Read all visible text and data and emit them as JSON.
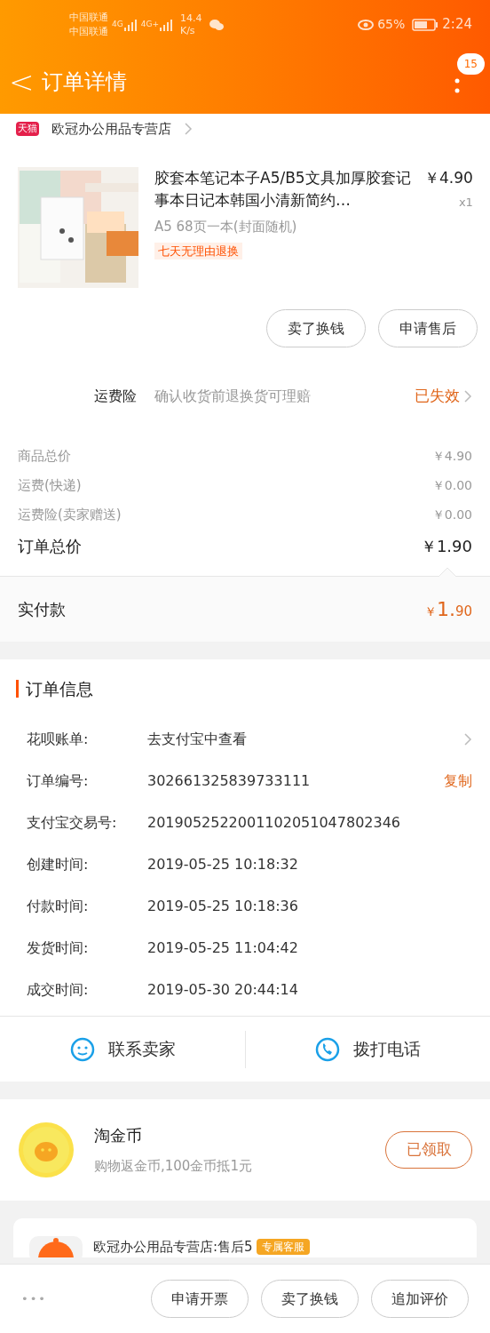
{
  "status_bar": {
    "carrier_1": "中国联通",
    "carrier_2": "中国联通",
    "network_1": "4G",
    "network_2": "4G+",
    "speed": "14.4",
    "speed_unit": "K/s",
    "battery": "65%",
    "time": "2:24"
  },
  "header": {
    "back": "<",
    "title": "订单详情",
    "badge": "15"
  },
  "store": {
    "badge": "天猫",
    "name": "欧冠办公用品专营店"
  },
  "product": {
    "title": "胶套本笔记本子A5/B5文具加厚胶套记事本日记本韩国小清新简约…",
    "price": "￥4.90",
    "quantity": "x1",
    "sku": "A5 68页一本(封面随机)",
    "tag": "七天无理由退换"
  },
  "item_buttons": [
    "卖了换钱",
    "申请售后"
  ],
  "insurance": {
    "label": "运费险",
    "description": "确认收货前退换货可理赔",
    "status": "已失效"
  },
  "price_rows": [
    {
      "label": "商品总价",
      "value": "￥4.90"
    },
    {
      "label": "运费(快递)",
      "value": "￥0.00"
    },
    {
      "label": "运费险(卖家赠送)",
      "value": "￥0.00"
    }
  ],
  "order_total": {
    "label": "订单总价",
    "value": "￥1.90"
  },
  "paid": {
    "label": "实付款",
    "currency": "￥",
    "integer": "1.",
    "decimal": "90"
  },
  "order_info": {
    "title": "订单信息",
    "rows": [
      {
        "label": "花呗账单:",
        "value": "去支付宝中查看",
        "kind": "link"
      },
      {
        "label": "订单编号:",
        "value": "302661325839733111",
        "action": "复制",
        "kind": "copy"
      },
      {
        "label": "支付宝交易号:",
        "value": "2019052522001102051047802346",
        "kind": "plain"
      },
      {
        "label": "创建时间:",
        "value": "2019-05-25 10:18:32",
        "kind": "plain"
      },
      {
        "label": "付款时间:",
        "value": "2019-05-25 10:18:36",
        "kind": "plain"
      },
      {
        "label": "发货时间:",
        "value": "2019-05-25 11:04:42",
        "kind": "plain"
      },
      {
        "label": "成交时间:",
        "value": "2019-05-30 20:44:14",
        "kind": "plain"
      }
    ]
  },
  "contact": [
    "联系卖家",
    "拨打电话"
  ],
  "coins": {
    "title": "淘金币",
    "subtitle": "购物返金币,100金币抵1元",
    "button": "已领取"
  },
  "service": {
    "name": "欧冠办公用品专营店:售后5",
    "tag": "专属客服"
  },
  "bottom_bar": {
    "more": "•••",
    "buttons": [
      "申请开票",
      "卖了换钱",
      "追加评价"
    ]
  }
}
